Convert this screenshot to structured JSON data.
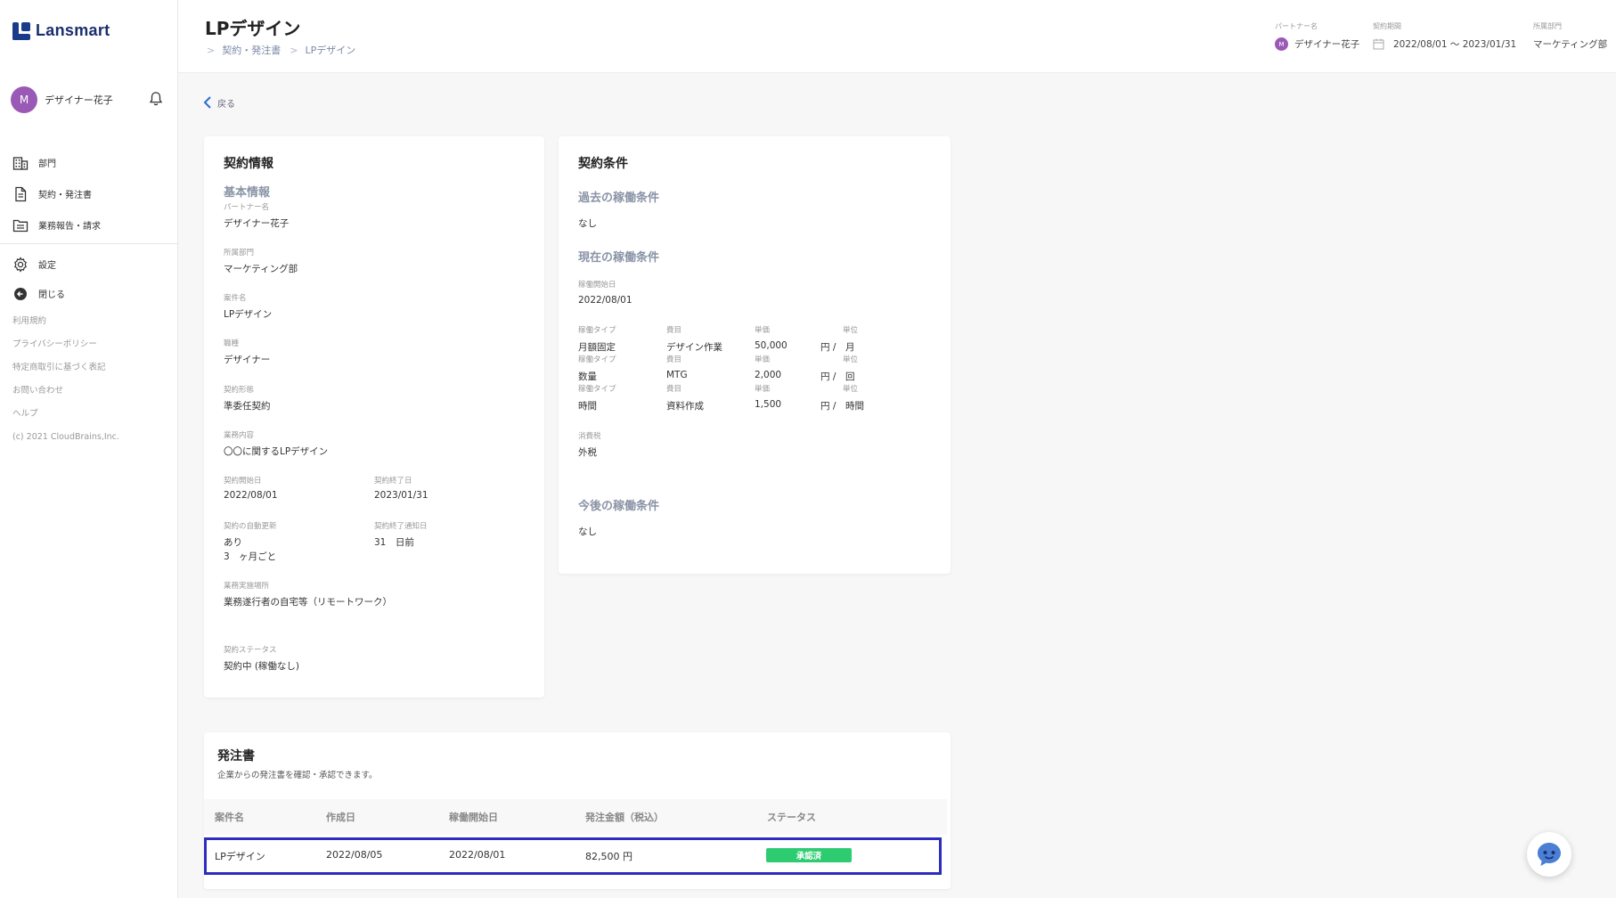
{
  "app": {
    "brand": "Lansmart"
  },
  "user": {
    "initial": "M",
    "name": "デザイナー花子"
  },
  "nav": {
    "items": [
      {
        "label": "部門",
        "icon": "building-icon"
      },
      {
        "label": "契約・発注書",
        "icon": "document-icon"
      },
      {
        "label": "業務報告・請求",
        "icon": "folder-icon"
      }
    ],
    "settings": "設定",
    "close": "閉じる"
  },
  "footer": {
    "links": [
      "利用規約",
      "プライバシーポリシー",
      "特定商取引に基づく表記",
      "お問い合わせ",
      "ヘルプ"
    ],
    "copyright": "(c) 2021 CloudBrains,Inc."
  },
  "header": {
    "title": "LPデザイン",
    "breadcrumb": [
      "契約・発注書",
      "LPデザイン"
    ],
    "partner_label": "パートナー名",
    "partner_initial": "M",
    "partner_value": "デザイナー花子",
    "period_label": "契約期間",
    "period_value": "2022/08/01 〜 2023/01/31",
    "dept_label": "所属部門",
    "dept_value": "マーケティング部"
  },
  "back_label": "戻る",
  "contract_info": {
    "title": "契約情報",
    "section": "基本情報",
    "partner_label": "パートナー名",
    "partner_value": "デザイナー花子",
    "dept_label": "所属部門",
    "dept_value": "マーケティング部",
    "project_label": "案件名",
    "project_value": "LPデザイン",
    "job_label": "職種",
    "job_value": "デザイナー",
    "form_label": "契約形態",
    "form_value": "準委任契約",
    "work_label": "業務内容",
    "work_value": "〇〇に関するLPデザイン",
    "start_label": "契約開始日",
    "start_value": "2022/08/01",
    "end_label": "契約終了日",
    "end_value": "2023/01/31",
    "renew_label": "契約の自動更新",
    "renew_value": "あり",
    "renew_period": "3　ヶ月ごと",
    "notice_label": "契約終了通知日",
    "notice_value": "31　日前",
    "place_label": "業務実施場所",
    "place_value": "業務遂行者の自宅等（リモートワーク）",
    "status_label": "契約ステータス",
    "status_value": "契約中 (稼働なし)"
  },
  "terms": {
    "title": "契約条件",
    "past_title": "過去の稼働条件",
    "past_value": "なし",
    "current_title": "現在の稼働条件",
    "start_label": "稼働開始日",
    "start_value": "2022/08/01",
    "col_type": "稼働タイプ",
    "col_item": "費目",
    "col_price": "単価",
    "col_unit": "単位",
    "rows": [
      {
        "type": "月額固定",
        "item": "デザイン作業",
        "price": "50,000",
        "yen": "円 /",
        "unit": "月"
      },
      {
        "type": "数量",
        "item": "MTG",
        "price": "2,000",
        "yen": "円 /",
        "unit": "回"
      },
      {
        "type": "時間",
        "item": "資料作成",
        "price": "1,500",
        "yen": "円 /",
        "unit": "時間"
      }
    ],
    "tax_label": "消費税",
    "tax_value": "外税",
    "future_title": "今後の稼働条件",
    "future_value": "なし"
  },
  "purchase_order": {
    "title": "発注書",
    "subtitle": "企業からの発注書を確認・承認できます。",
    "columns": [
      "案件名",
      "作成日",
      "稼働開始日",
      "発注金額（税込）",
      "ステータス"
    ],
    "row": {
      "project": "LPデザイン",
      "created": "2022/08/05",
      "start": "2022/08/01",
      "amount": "82,500 円",
      "status": "承認済"
    }
  },
  "colors": {
    "accent": "#1a2e6e",
    "avatar": "#9b59b6",
    "approved": "#2ecc71",
    "highlight": "#2c2cc0"
  }
}
